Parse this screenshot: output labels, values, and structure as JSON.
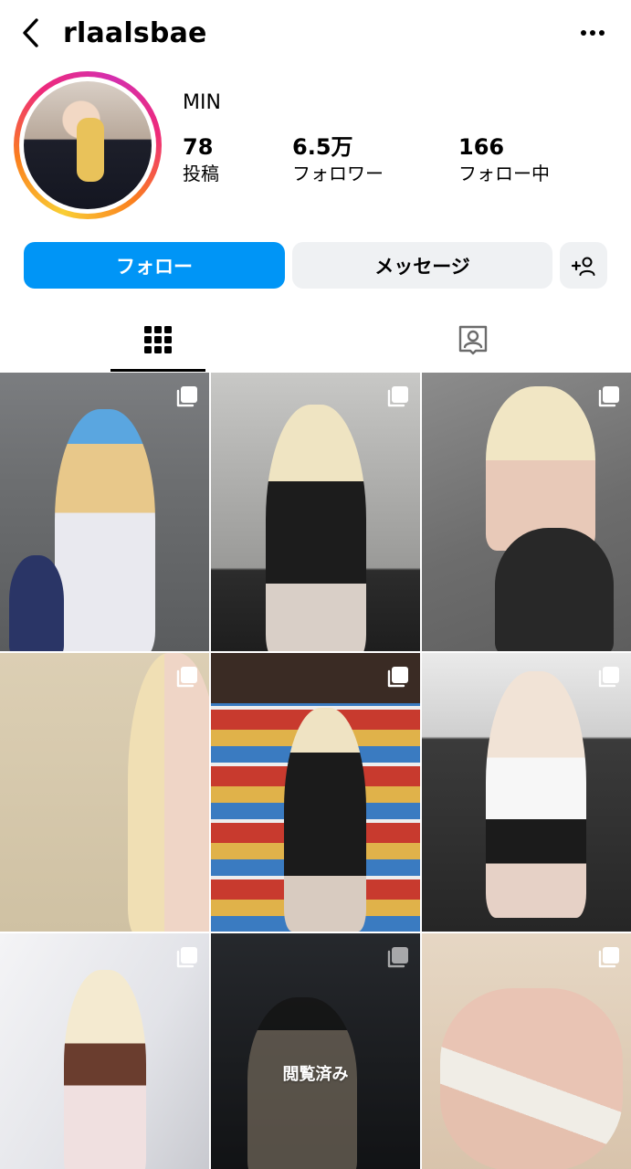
{
  "header": {
    "username": "rlaalsbae",
    "back_icon": "chevron-left-icon",
    "more_icon": "more-horizontal-icon"
  },
  "profile": {
    "display_name": "MIN",
    "stats": [
      {
        "value": "78",
        "label": "投稿"
      },
      {
        "value": "6.5万",
        "label": "フォロワー"
      },
      {
        "value": "166",
        "label": "フォロー中"
      }
    ],
    "story_ring_colors": [
      "#f9ce34",
      "#fa7e1e",
      "#ee2a7b",
      "#d42fae"
    ]
  },
  "actions": {
    "follow_label": "フォロー",
    "message_label": "メッセージ",
    "suggest_icon": "add-person-icon",
    "follow_color": "#0095f6",
    "secondary_color": "#eff1f3"
  },
  "tabs": [
    {
      "icon": "grid-icon",
      "selected": true
    },
    {
      "icon": "tagged-person-icon",
      "selected": false
    }
  ],
  "posts": [
    {
      "multi": true
    },
    {
      "multi": true
    },
    {
      "multi": true
    },
    {
      "multi": true
    },
    {
      "multi": true
    },
    {
      "multi": true
    },
    {
      "multi": true
    },
    {
      "multi": true,
      "overlay": "閲覧済み"
    },
    {
      "multi": true
    }
  ]
}
